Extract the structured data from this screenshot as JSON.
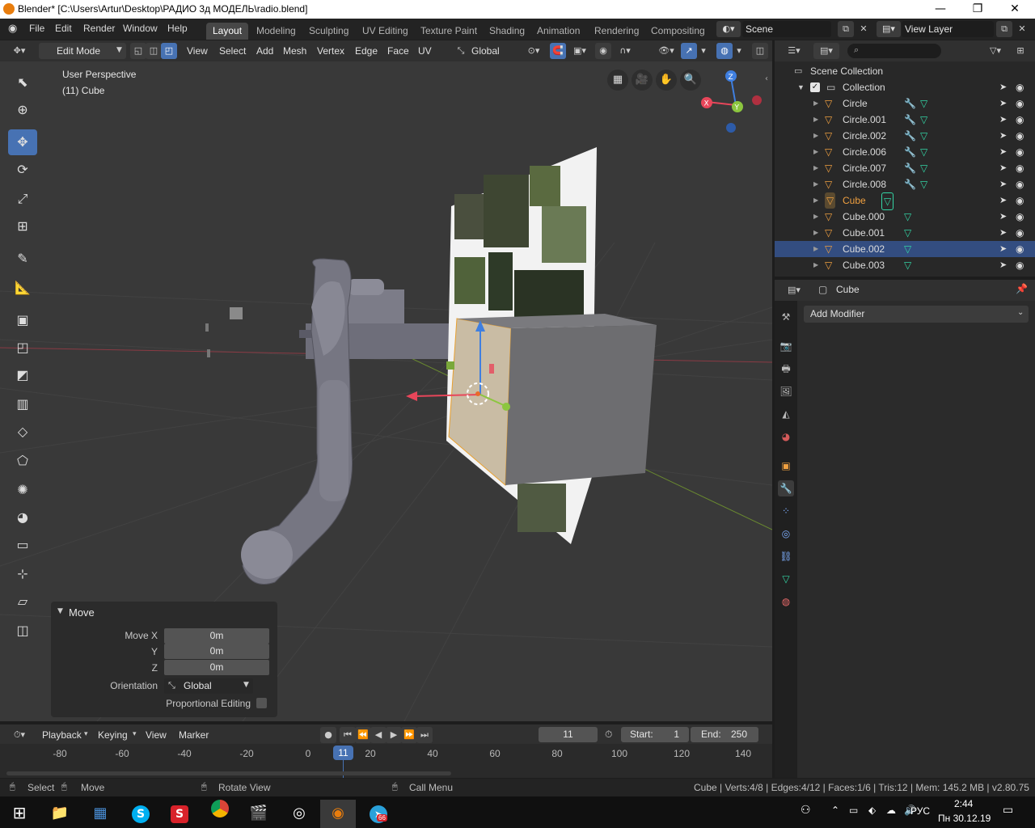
{
  "window": {
    "title": "Blender* [C:\\Users\\Artur\\Desktop\\РАДИО 3д МОДЕЛЬ\\radio.blend]",
    "minimize": "—",
    "maximize": "❐",
    "close": "✕"
  },
  "menubar": {
    "items": [
      "File",
      "Edit",
      "Render",
      "Window",
      "Help"
    ],
    "workspaces": [
      "Layout",
      "Modeling",
      "Sculpting",
      "UV Editing",
      "Texture Paint",
      "Shading",
      "Animation",
      "Rendering",
      "Compositing"
    ],
    "active_workspace": "Layout",
    "scene": "Scene",
    "view_layer": "View Layer"
  },
  "viewport_header": {
    "mode": "Edit Mode",
    "menus": [
      "View",
      "Select",
      "Add",
      "Mesh",
      "Vertex",
      "Edge",
      "Face",
      "UV"
    ],
    "orientation": "Global"
  },
  "viewport": {
    "perspective_label": "User Perspective",
    "object_label": "(11) Cube",
    "gizmo_axes": [
      "X",
      "Y",
      "Z"
    ],
    "colors": {
      "background": "#393939",
      "x_axis": "#e8465a",
      "y_axis": "#8cc63f",
      "z_axis": "#3f7fe0",
      "selection_blue": "#4772b3"
    }
  },
  "operator_panel": {
    "title": "Move",
    "fields": [
      {
        "label": "Move X",
        "value": "0m"
      },
      {
        "label": "Y",
        "value": "0m"
      },
      {
        "label": "Z",
        "value": "0m"
      }
    ],
    "orientation_label": "Orientation",
    "orientation_value": "Global",
    "proportional_label": "Proportional Editing"
  },
  "timeline": {
    "menus": [
      "Playback",
      "Keying",
      "View",
      "Marker"
    ],
    "current_frame": "11",
    "start_label": "Start:",
    "start": "1",
    "end_label": "End:",
    "end": "250",
    "ruler_ticks": [
      "-80",
      "-60",
      "-40",
      "-20",
      "0",
      "20",
      "40",
      "60",
      "80",
      "100",
      "120",
      "140"
    ]
  },
  "outliner": {
    "scene_collection": "Scene Collection",
    "collection": "Collection",
    "objects": [
      {
        "name": "Circle",
        "modifier": true,
        "active": false,
        "selected": false
      },
      {
        "name": "Circle.001",
        "modifier": true,
        "active": false,
        "selected": false
      },
      {
        "name": "Circle.002",
        "modifier": true,
        "active": false,
        "selected": false
      },
      {
        "name": "Circle.006",
        "modifier": true,
        "active": false,
        "selected": false
      },
      {
        "name": "Circle.007",
        "modifier": true,
        "active": false,
        "selected": false
      },
      {
        "name": "Circle.008",
        "modifier": true,
        "active": false,
        "selected": false
      },
      {
        "name": "Cube",
        "modifier": false,
        "active": true,
        "selected": false
      },
      {
        "name": "Cube.000",
        "modifier": false,
        "active": false,
        "selected": false
      },
      {
        "name": "Cube.001",
        "modifier": false,
        "active": false,
        "selected": false
      },
      {
        "name": "Cube.002",
        "modifier": false,
        "active": false,
        "selected": true
      },
      {
        "name": "Cube.003",
        "modifier": false,
        "active": false,
        "selected": false
      }
    ]
  },
  "properties": {
    "object_name": "Cube",
    "add_modifier": "Add Modifier"
  },
  "statusbar": {
    "select": "Select",
    "move": "Move",
    "rotate_view": "Rotate View",
    "call_menu": "Call Menu",
    "stats": "Cube | Verts:4/8 | Edges:4/12 | Faces:1/6 | Tris:12 | Mem: 145.2 MB | v2.80.75"
  },
  "taskbar": {
    "language": "РУС",
    "time": "2:44",
    "date": "Пн 30.12.19",
    "telegram_badge": "66"
  }
}
